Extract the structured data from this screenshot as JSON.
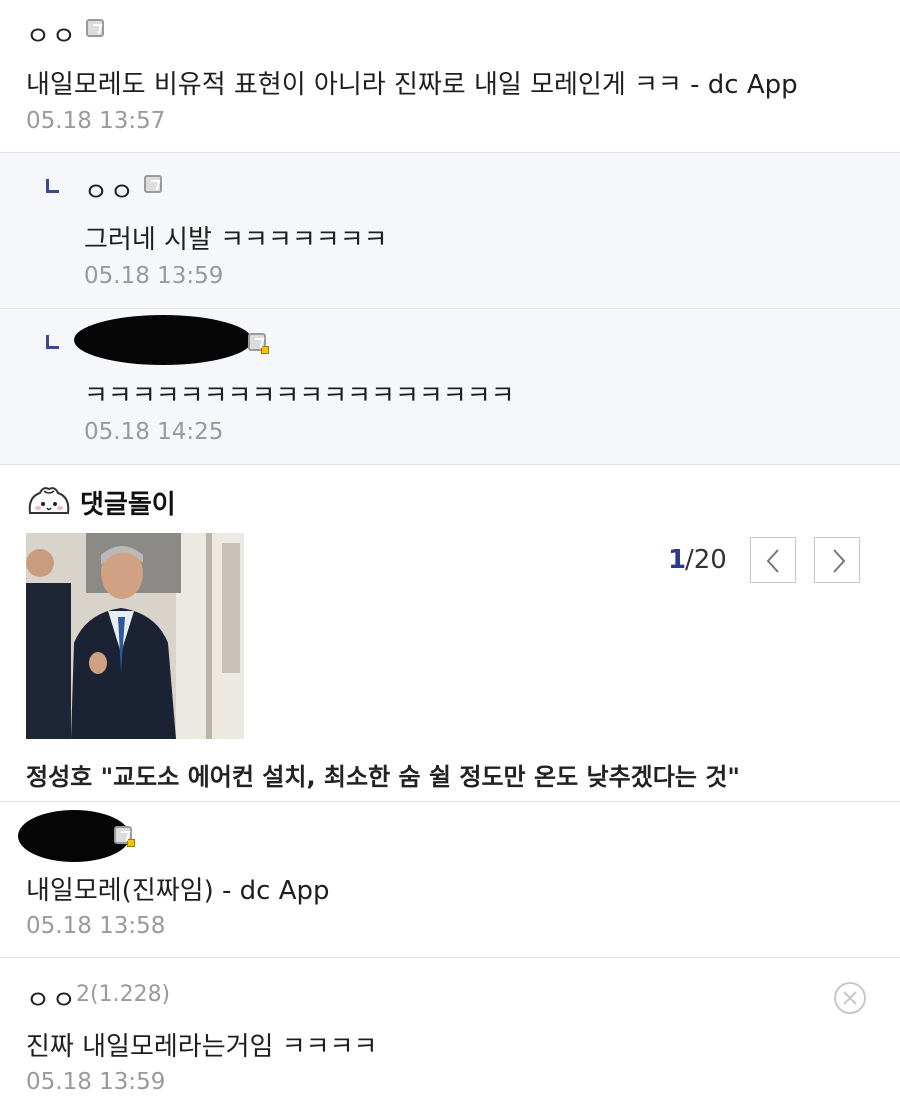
{
  "comments": [
    {
      "author": "ㅇㅇ",
      "text": "내일모레도 비유적 표현이 아니라 진짜로 내일 모레인게 ㅋㅋ - dc App",
      "date": "05.18 13:57",
      "icon": "mobile-icon"
    },
    {
      "author": "ㅇㅇ",
      "text": "그러네 시발 ㅋㅋㅋㅋㅋㅋㅋ",
      "date": "05.18 13:59",
      "reply": true,
      "icon": "mobile-icon"
    },
    {
      "author": "",
      "redacted": true,
      "text": "ㅋㅋㅋㅋㅋㅋㅋㅋㅋㅋㅋㅋㅋㅋㅋㅋㅋㅋ",
      "date": "05.18 14:25",
      "reply": true,
      "icon": "mobile-icon"
    },
    {
      "author": "",
      "redacted": true,
      "text": "내일모레(진짜임) - dc App",
      "date": "05.18 13:58",
      "icon": "mobile-icon"
    },
    {
      "author": "ㅇㅇ",
      "ip": "2(1.228)",
      "text": "진짜 내일모레라는거임 ㅋㅋㅋㅋ",
      "date": "05.18 13:59",
      "icon": "delete-icon"
    }
  ],
  "bot": {
    "title": "댓글돌이",
    "page_current": "1",
    "page_total": "/20",
    "headline": "정성호 \"교도소 에어컨 설치, 최소한 숨 쉴 정도만 온도 낮추겠다는 것\"",
    "image_subject": "news photo of a man in a dark suit walking in a corridor"
  },
  "colors": {
    "reply_background": "#f5f7fb",
    "reply_marker": "#3b4a8a",
    "date_text": "#9a9a9a",
    "page_current": "#2b3a8a"
  }
}
